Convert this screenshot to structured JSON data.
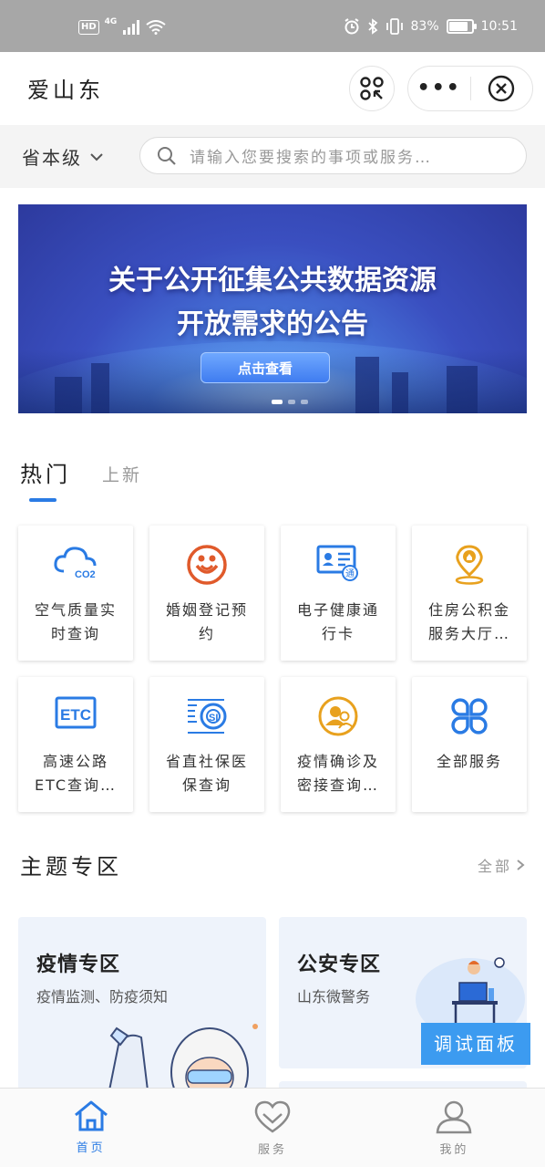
{
  "status_bar": {
    "hd": "HD",
    "network": "4G",
    "battery_percent": "83%",
    "battery_level": 0.83,
    "time": "10:51"
  },
  "nav": {
    "title": "爱山东",
    "more": "•••"
  },
  "search": {
    "region": "省本级",
    "placeholder": "请输入您要搜索的事项或服务…"
  },
  "banner": {
    "line1": "关于公开征集公共数据资源",
    "line2": "开放需求的公告",
    "cta": "点击查看",
    "slide_count": 3,
    "active_slide": 1
  },
  "tabs": {
    "hot": "热门",
    "new": "上新"
  },
  "services": [
    {
      "label": "空气质量实时查询",
      "icon": "cloud-co2-icon",
      "color": "#2a7be4"
    },
    {
      "label": "婚姻登记预约",
      "icon": "marriage-icon",
      "color": "#e05a2b"
    },
    {
      "label": "电子健康通行卡",
      "icon": "health-card-icon",
      "color": "#2a7be4"
    },
    {
      "label": "住房公积金服务大厅…",
      "icon": "housing-fund-icon",
      "color": "#e8a11e"
    },
    {
      "label": "高速公路ETC查询…",
      "icon": "etc-icon",
      "color": "#2a7be4"
    },
    {
      "label": "省直社保医保查询",
      "icon": "social-security-icon",
      "color": "#2a7be4"
    },
    {
      "label": "疫情确诊及密接查询…",
      "icon": "contacts-icon",
      "color": "#e8a11e"
    },
    {
      "label": "全部服务",
      "icon": "all-services-icon",
      "color": "#2a7be4"
    }
  ],
  "topics": {
    "title": "主题专区",
    "more": "全部",
    "items": [
      {
        "title": "疫情专区",
        "subtitle": "疫情监测、防疫须知"
      },
      {
        "title": "公安专区",
        "subtitle": "山东微警务"
      }
    ]
  },
  "debug_panel": "调试面板",
  "tabbar": [
    {
      "label": "首页",
      "icon": "home-icon",
      "active": true
    },
    {
      "label": "服务",
      "icon": "heart-icon",
      "active": false
    },
    {
      "label": "我的",
      "icon": "user-icon",
      "active": false
    }
  ]
}
